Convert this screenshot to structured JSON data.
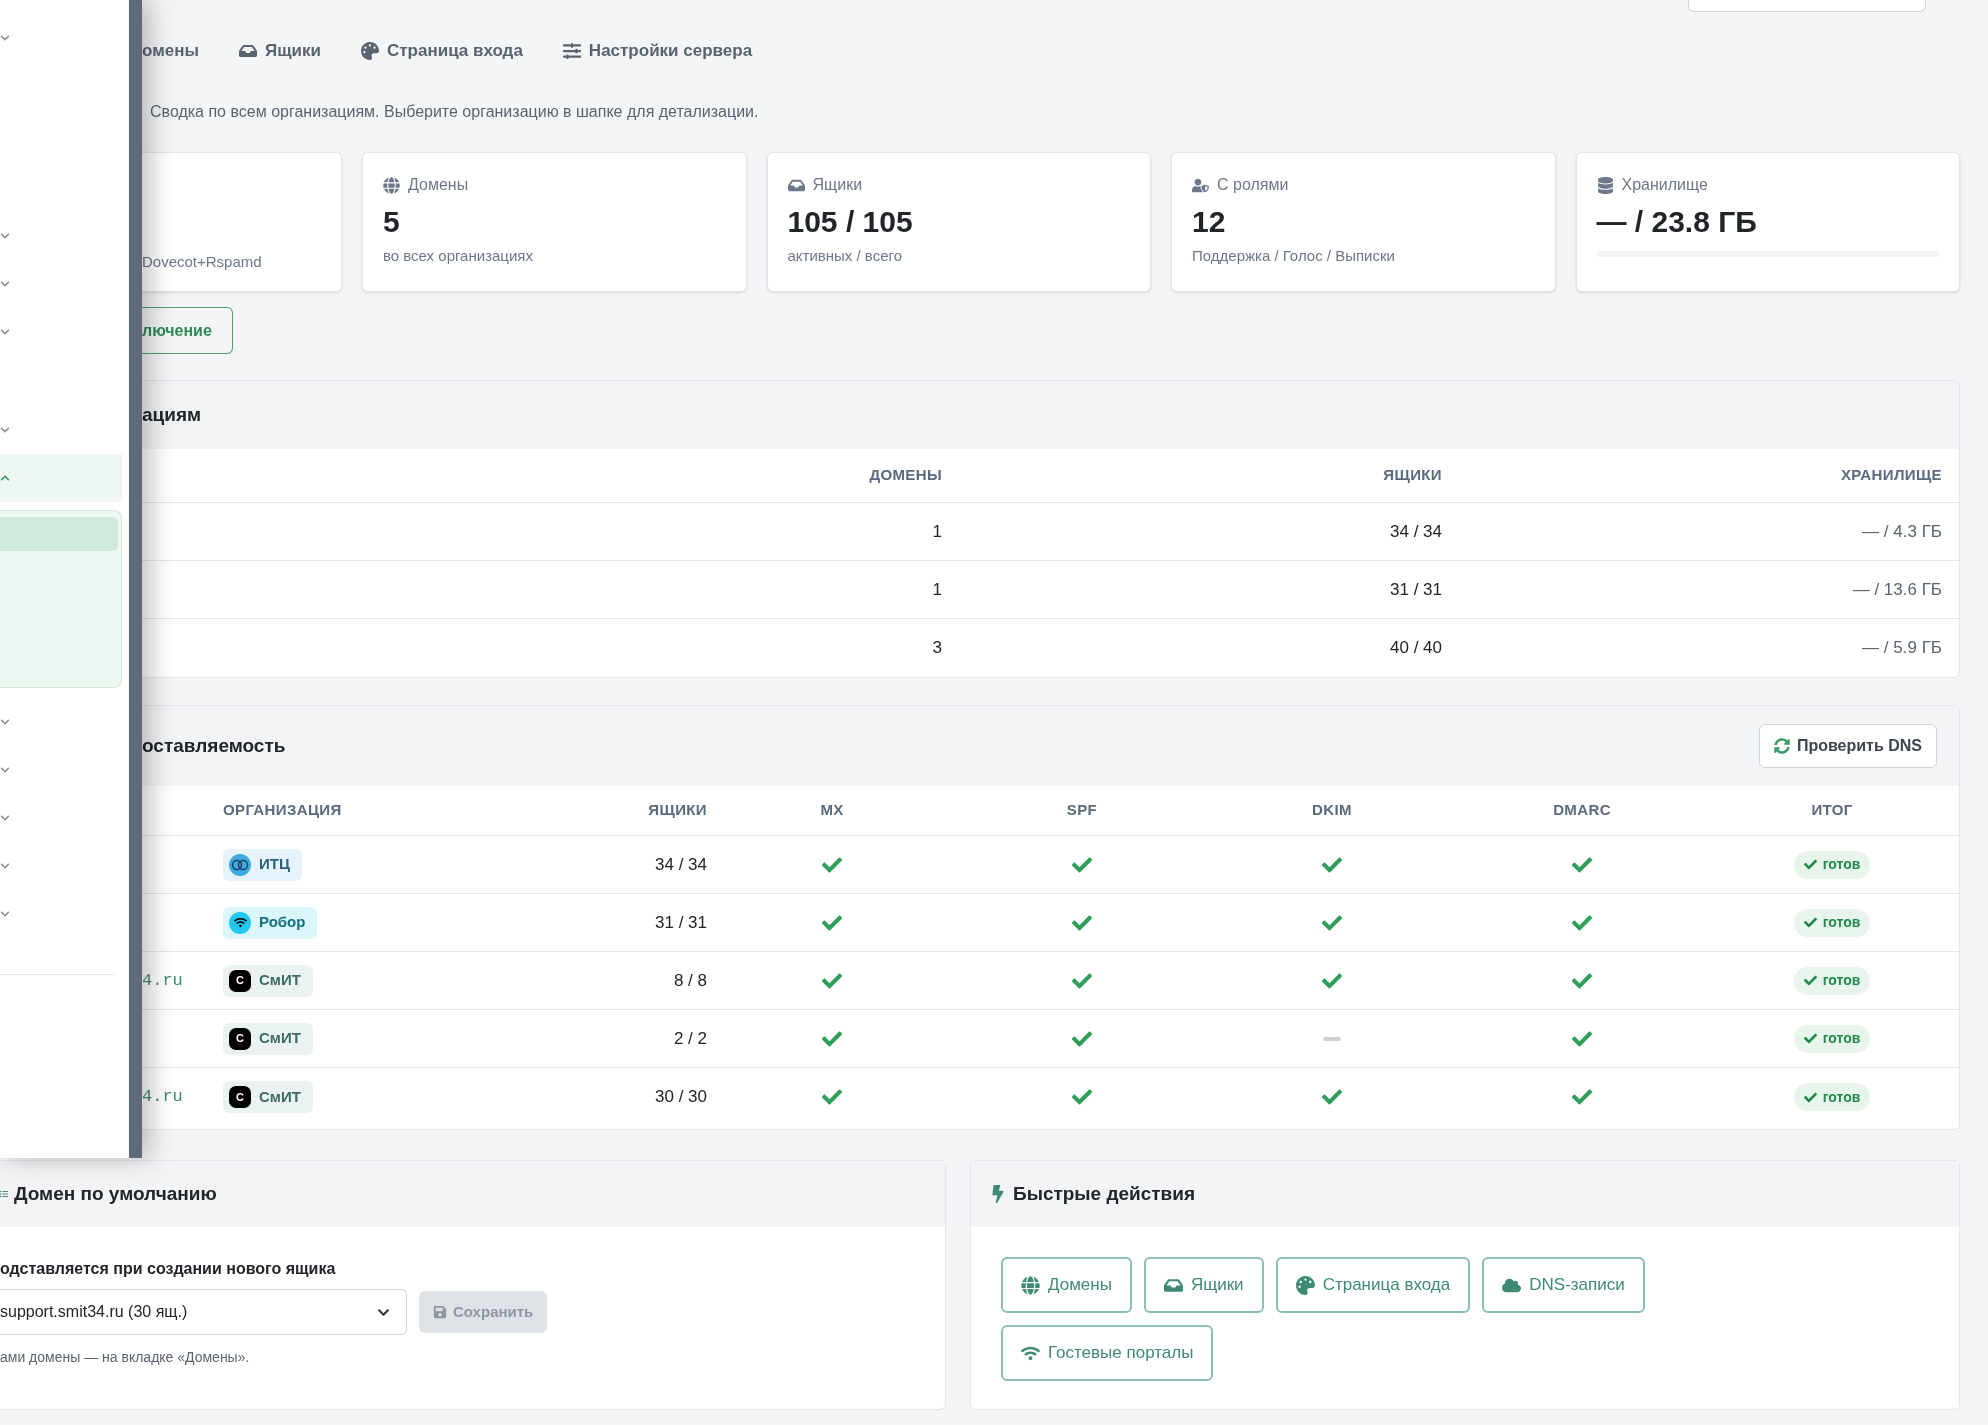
{
  "drawer": {
    "sections": [
      {
        "items": [
          {
            "expanded": false
          }
        ]
      },
      {
        "items": [
          {
            "expanded": false
          },
          {
            "expanded": false
          },
          {
            "expanded": false
          }
        ]
      },
      {
        "items": [
          {
            "expanded": false
          },
          {
            "expanded": true,
            "children": [
              {
                "selected": true
              }
            ]
          }
        ]
      },
      {
        "items": [
          {
            "expanded": false
          },
          {
            "expanded": false
          },
          {
            "expanded": false
          },
          {
            "expanded": false
          },
          {
            "expanded": false
          }
        ]
      }
    ]
  },
  "tabs": [
    {
      "label": "омены"
    },
    {
      "label": "Ящики"
    },
    {
      "label": "Страница входа"
    },
    {
      "label": "Настройки сервера"
    }
  ],
  "description": "Сводка по всем организациям. Выберите организацию в шапке для детализации.",
  "stats": [
    {
      "note": "Dovecot+Rspamd"
    },
    {
      "label": "Домены",
      "value": "5",
      "note": "во всех организациях"
    },
    {
      "label": "Ящики",
      "value": "105 / 105",
      "note": "активных / всего"
    },
    {
      "label": "С ролями",
      "value": "12",
      "note": "Поддержка / Голос / Выписки"
    },
    {
      "label": "Хранилище",
      "value": "— / 23.8 ГБ",
      "level": 0
    }
  ],
  "connect_button": "лючение",
  "org_table": {
    "title": "ациям",
    "columns": [
      "ДОМЕНЫ",
      "ЯЩИКИ",
      "ХРАНИЛИЩЕ"
    ],
    "rows": [
      {
        "domains": "1",
        "mailboxes": "34 / 34",
        "storage": "— / 4.3 ГБ"
      },
      {
        "domains": "1",
        "mailboxes": "31 / 31",
        "storage": "— / 13.6 ГБ"
      },
      {
        "domains": "3",
        "mailboxes": "40 / 40",
        "storage": "— / 5.9 ГБ"
      }
    ]
  },
  "deliverability": {
    "title": "оставляемость",
    "check_button": "Проверить DNS",
    "columns": [
      "ОРГАНИЗАЦИЯ",
      "ЯЩИКИ",
      "MX",
      "SPF",
      "DKIM",
      "DMARC",
      "ИТОГ"
    ],
    "rows": [
      {
        "org": {
          "kind": "emblem",
          "name": "ИТЦ"
        },
        "mailboxes": "34 / 34",
        "mx": true,
        "spf": true,
        "dkim": true,
        "dmarc": true,
        "result": {
          "text": "готов",
          "ready": true
        }
      },
      {
        "org": {
          "kind": "signal",
          "name": "Робор"
        },
        "mailboxes": "31 / 31",
        "mx": true,
        "spf": true,
        "dkim": true,
        "dmarc": true,
        "result": {
          "text": "готов",
          "ready": true
        }
      },
      {
        "domain": "4.ru",
        "org": {
          "kind": "letter",
          "logo_text": "C",
          "name": "СмИТ"
        },
        "mailboxes": "8 / 8",
        "mx": true,
        "spf": true,
        "dkim": true,
        "dmarc": true,
        "result": {
          "text": "готов",
          "ready": true
        }
      },
      {
        "org": {
          "kind": "letter",
          "logo_text": "C",
          "name": "СмИТ"
        },
        "mailboxes": "2 / 2",
        "mx": true,
        "spf": true,
        "dkim": false,
        "dmarc": true,
        "result": {
          "text": "готов",
          "ready": true
        }
      },
      {
        "domain": "4.ru",
        "org": {
          "kind": "letter",
          "logo_text": "C",
          "name": "СмИТ"
        },
        "mailboxes": "30 / 30",
        "mx": true,
        "spf": true,
        "dkim": true,
        "dmarc": true,
        "result": {
          "text": "готов",
          "ready": true
        }
      }
    ]
  },
  "default_domain": {
    "title": "Домен по умолчанию",
    "label": "одставляется при создании нового ящика",
    "value": "support.smit34.ru (30 ящ.)",
    "save_button": {
      "label": "Сохранить",
      "disabled": true
    },
    "hint": "ами домены — на вкладке «Домены»."
  },
  "quick_actions": {
    "title": "Быстрые действия",
    "buttons": [
      "Домены",
      "Ящики",
      "Страница входа",
      "DNS-записи",
      "Гостевые порталы"
    ]
  }
}
